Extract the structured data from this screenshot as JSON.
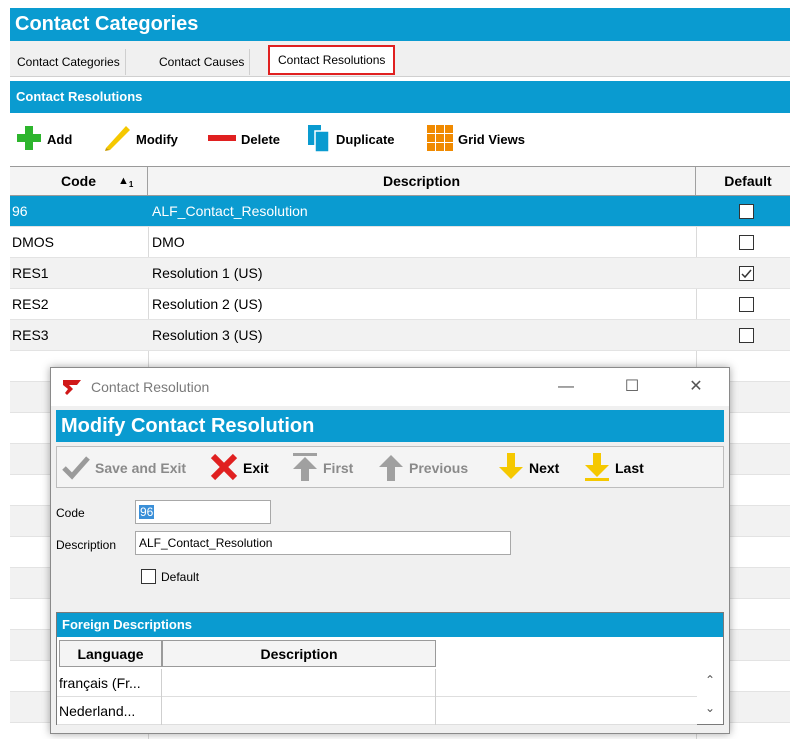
{
  "app": {
    "title": "Contact Categories"
  },
  "tabs": [
    {
      "label": "Contact Categories"
    },
    {
      "label": "Contact Causes"
    },
    {
      "label": "Contact Resolutions"
    }
  ],
  "section": {
    "title": "Contact Resolutions"
  },
  "toolbar": {
    "add": "Add",
    "modify": "Modify",
    "delete": "Delete",
    "duplicate": "Duplicate",
    "grid_views": "Grid Views"
  },
  "grid": {
    "columns": {
      "code": "Code",
      "description": "Description",
      "default": "Default"
    },
    "rows": [
      {
        "code": "96",
        "description": "ALF_Contact_Resolution",
        "default": false
      },
      {
        "code": "DMOS",
        "description": "DMO",
        "default": false
      },
      {
        "code": "RES1",
        "description": "Resolution 1 (US)",
        "default": true
      },
      {
        "code": "RES2",
        "description": "Resolution 2 (US)",
        "default": false
      },
      {
        "code": "RES3",
        "description": "Resolution 3 (US)",
        "default": false
      }
    ]
  },
  "dialog": {
    "window_title": "Contact Resolution",
    "header": "Modify Contact Resolution",
    "toolbar": {
      "save_exit": "Save and Exit",
      "exit": "Exit",
      "first": "First",
      "previous": "Previous",
      "next": "Next",
      "last": "Last"
    },
    "form": {
      "code_label": "Code",
      "code_value": "96",
      "description_label": "Description",
      "description_value": "ALF_Contact_Resolution",
      "default_label": "Default",
      "default_checked": false
    },
    "foreign": {
      "title": "Foreign Descriptions",
      "columns": {
        "language": "Language",
        "description": "Description"
      },
      "rows": [
        {
          "language": "français (Fr...",
          "description": ""
        },
        {
          "language": "Nederland...",
          "description": ""
        }
      ]
    }
  },
  "colors": {
    "accent": "#0a9bd0",
    "tab_highlight": "#e02020",
    "add_green": "#2db52d",
    "delete_red": "#e02020",
    "nav_yellow": "#f5c800"
  }
}
